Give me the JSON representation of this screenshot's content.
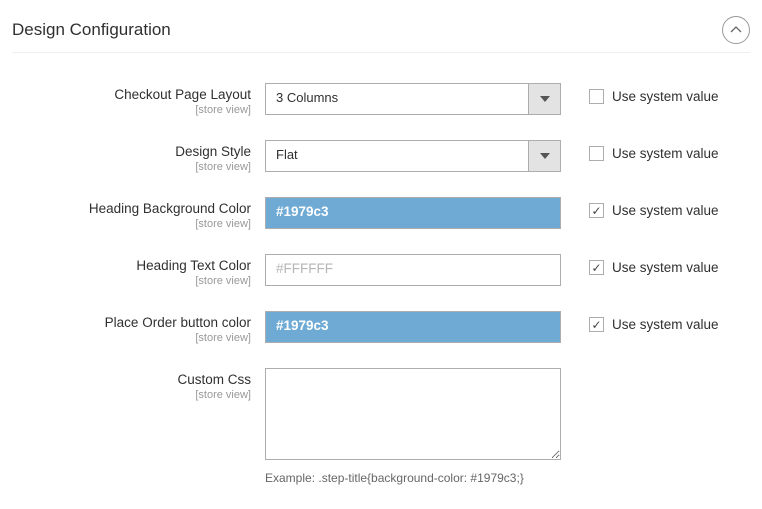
{
  "section": {
    "title": "Design Configuration"
  },
  "common": {
    "scope": "[store view]",
    "use_system_label": "Use system value"
  },
  "rows": {
    "layout": {
      "label": "Checkout Page Layout",
      "value": "3 Columns",
      "checked": false
    },
    "style": {
      "label": "Design Style",
      "value": "Flat",
      "checked": false
    },
    "heading_bg": {
      "label": "Heading Background Color",
      "value": "#1979c3",
      "checked": true
    },
    "heading_text": {
      "label": "Heading Text Color",
      "value": "#FFFFFF",
      "checked": true
    },
    "place_order": {
      "label": "Place Order button color",
      "value": "#1979c3",
      "checked": true
    },
    "custom_css": {
      "label": "Custom Css",
      "value": "",
      "hint": "Example: .step-title{background-color: #1979c3;}"
    }
  }
}
